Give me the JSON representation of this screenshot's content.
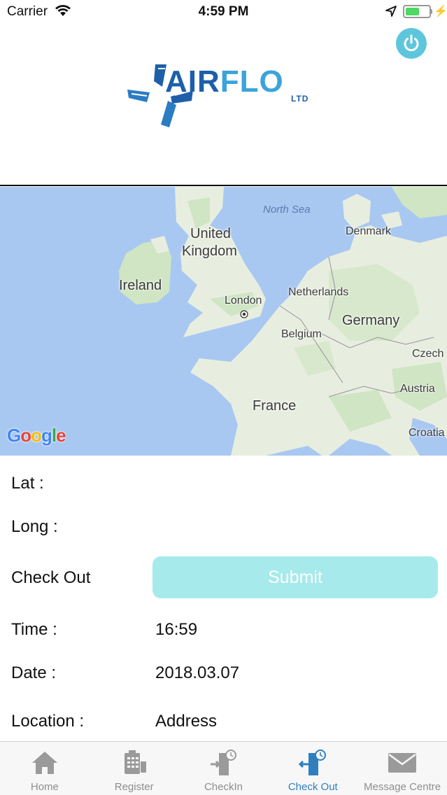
{
  "status_bar": {
    "carrier": "Carrier",
    "time": "4:59 PM",
    "battery_level": 0.58
  },
  "header": {
    "logo_primary": "AIR",
    "logo_secondary": "FLO",
    "logo_suffix": "LTD",
    "power_icon": "power-icon"
  },
  "map": {
    "labels": {
      "north_sea": "North Sea",
      "united_kingdom_1": "United",
      "united_kingdom_2": "Kingdom",
      "ireland": "Ireland",
      "london": "London",
      "denmark": "Denmark",
      "netherlands": "Netherlands",
      "germany": "Germany",
      "belgium": "Belgium",
      "czech": "Czech",
      "austria": "Austria",
      "france": "France",
      "croatia": "Croatia"
    },
    "attribution": "Google",
    "colors": {
      "water": "#a8c8f2",
      "land": "#e8eedf",
      "green": "#cfe5c4"
    }
  },
  "form": {
    "lat_label": "Lat :",
    "long_label": "Long :",
    "checkout_label": "Check Out",
    "submit_label": "Submit",
    "time_label": "Time :",
    "time_value": "16:59",
    "date_label": "Date :",
    "date_value": "2018.03.07",
    "location_label": "Location :",
    "location_value": "Address"
  },
  "tabs": [
    {
      "label": "Home",
      "icon": "home-icon",
      "active": false
    },
    {
      "label": "Register",
      "icon": "register-icon",
      "active": false
    },
    {
      "label": "CheckIn",
      "icon": "checkin-icon",
      "active": false
    },
    {
      "label": "Check Out",
      "icon": "checkout-icon",
      "active": true
    },
    {
      "label": "Message Centre",
      "icon": "mail-icon",
      "active": false
    }
  ],
  "colors": {
    "accent": "#5ec6dc",
    "submit_bg": "#a6eaec",
    "tab_active": "#2f7fbf",
    "tab_inactive": "#8e8e8e"
  }
}
